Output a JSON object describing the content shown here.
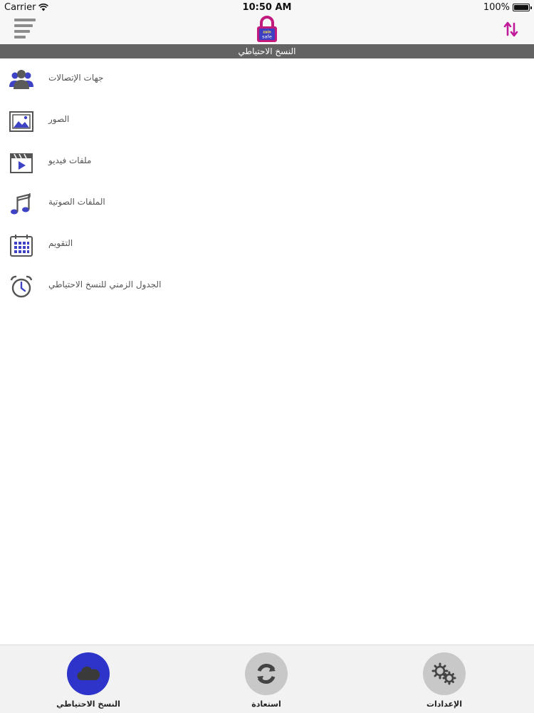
{
  "status_bar": {
    "carrier": "Carrier",
    "time": "10:50 AM",
    "battery": "100%"
  },
  "nav": {
    "logo_text": "zain safe",
    "menu_icon": "hamburger-icon",
    "sort_icon": "sort-arrows-icon"
  },
  "section": {
    "title": "النسخ الاحتياطي"
  },
  "list": {
    "items": [
      {
        "label": "جهات الإتصالات",
        "icon": "contacts-icon"
      },
      {
        "label": "الصور",
        "icon": "photos-icon"
      },
      {
        "label": "ملفات فيديو",
        "icon": "video-icon"
      },
      {
        "label": "الملفات الصوتية",
        "icon": "music-icon"
      },
      {
        "label": "التقويم",
        "icon": "calendar-icon"
      },
      {
        "label": "الجدول الزمني للنسخ الاحتياطي",
        "icon": "alarm-clock-icon"
      }
    ]
  },
  "tabs": [
    {
      "label": "النسخ الاحتياطي",
      "icon": "cloud-icon",
      "active": true
    },
    {
      "label": "استعادة",
      "icon": "restore-icon",
      "active": false
    },
    {
      "label": "الإعدادات",
      "icon": "gears-icon",
      "active": false
    }
  ],
  "colors": {
    "accent": "#2e33c9",
    "icon_blue": "#3d43c4",
    "sort_magenta": "#c21b9a",
    "header_gray": "#636363"
  }
}
